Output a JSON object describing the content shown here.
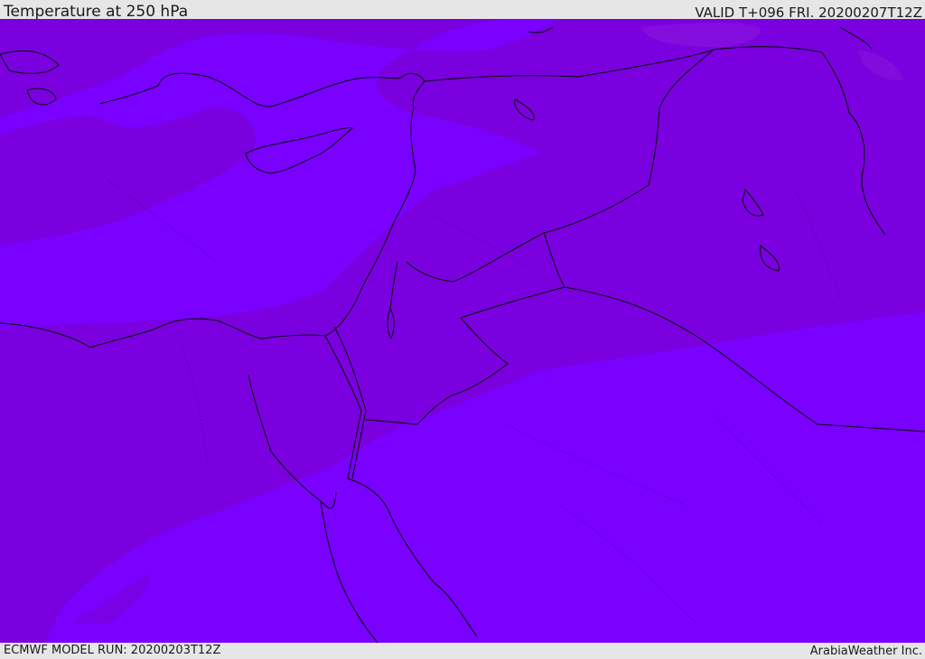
{
  "header": {
    "title": "Temperature at 250 hPa",
    "valid": "VALID T+096 FRI. 20200207T12Z"
  },
  "footer": {
    "model_run": "ECMWF MODEL RUN: 20200203T12Z",
    "credit": "ArabiaWeather Inc."
  },
  "map": {
    "shading_colors": {
      "dark_violet": "#7a00df",
      "light_violet": "#7a00ff",
      "darkest_violet": "#8a18d8"
    },
    "outline_color": "#000000"
  }
}
